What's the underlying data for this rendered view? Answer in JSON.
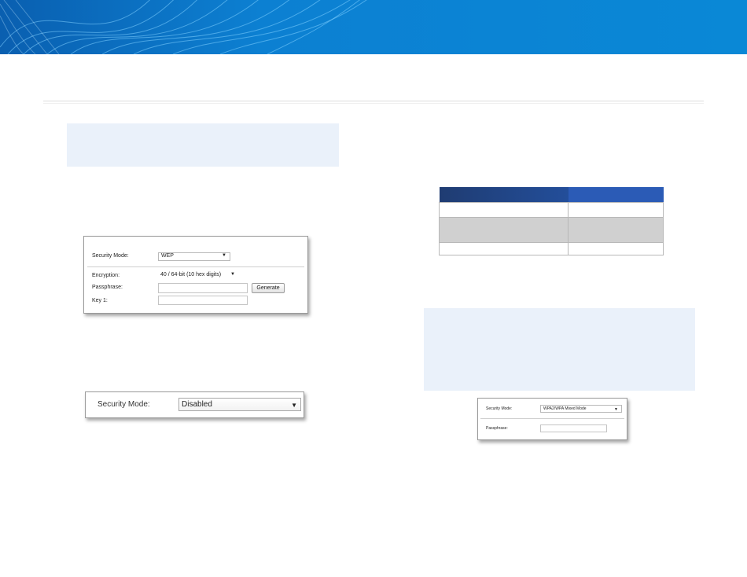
{
  "colors": {
    "banner": "#0b78cc",
    "note_box": "#eaf1fa",
    "table_header_dark": "#1f3c72",
    "table_header_light": "#2b5bb6",
    "table_shaded_row": "#d0d0d0"
  },
  "wep_panel": {
    "security_mode_label": "Security Mode:",
    "security_mode_value": "WEP",
    "encryption_label": "Encryption:",
    "encryption_value": "40 / 64-bit (10 hex digits)",
    "passphrase_label": "Passphrase:",
    "generate_label": "Generate",
    "key1_label": "Key 1:"
  },
  "disabled_panel": {
    "security_mode_label": "Security Mode:",
    "security_mode_value": "Disabled"
  },
  "wpa_panel": {
    "security_mode_label": "Security Mode:",
    "security_mode_value": "WPA2/WPA Mixed Mode",
    "passphrase_label": "Passphrase:"
  },
  "icons": {
    "dropdown": "triangle-down"
  }
}
